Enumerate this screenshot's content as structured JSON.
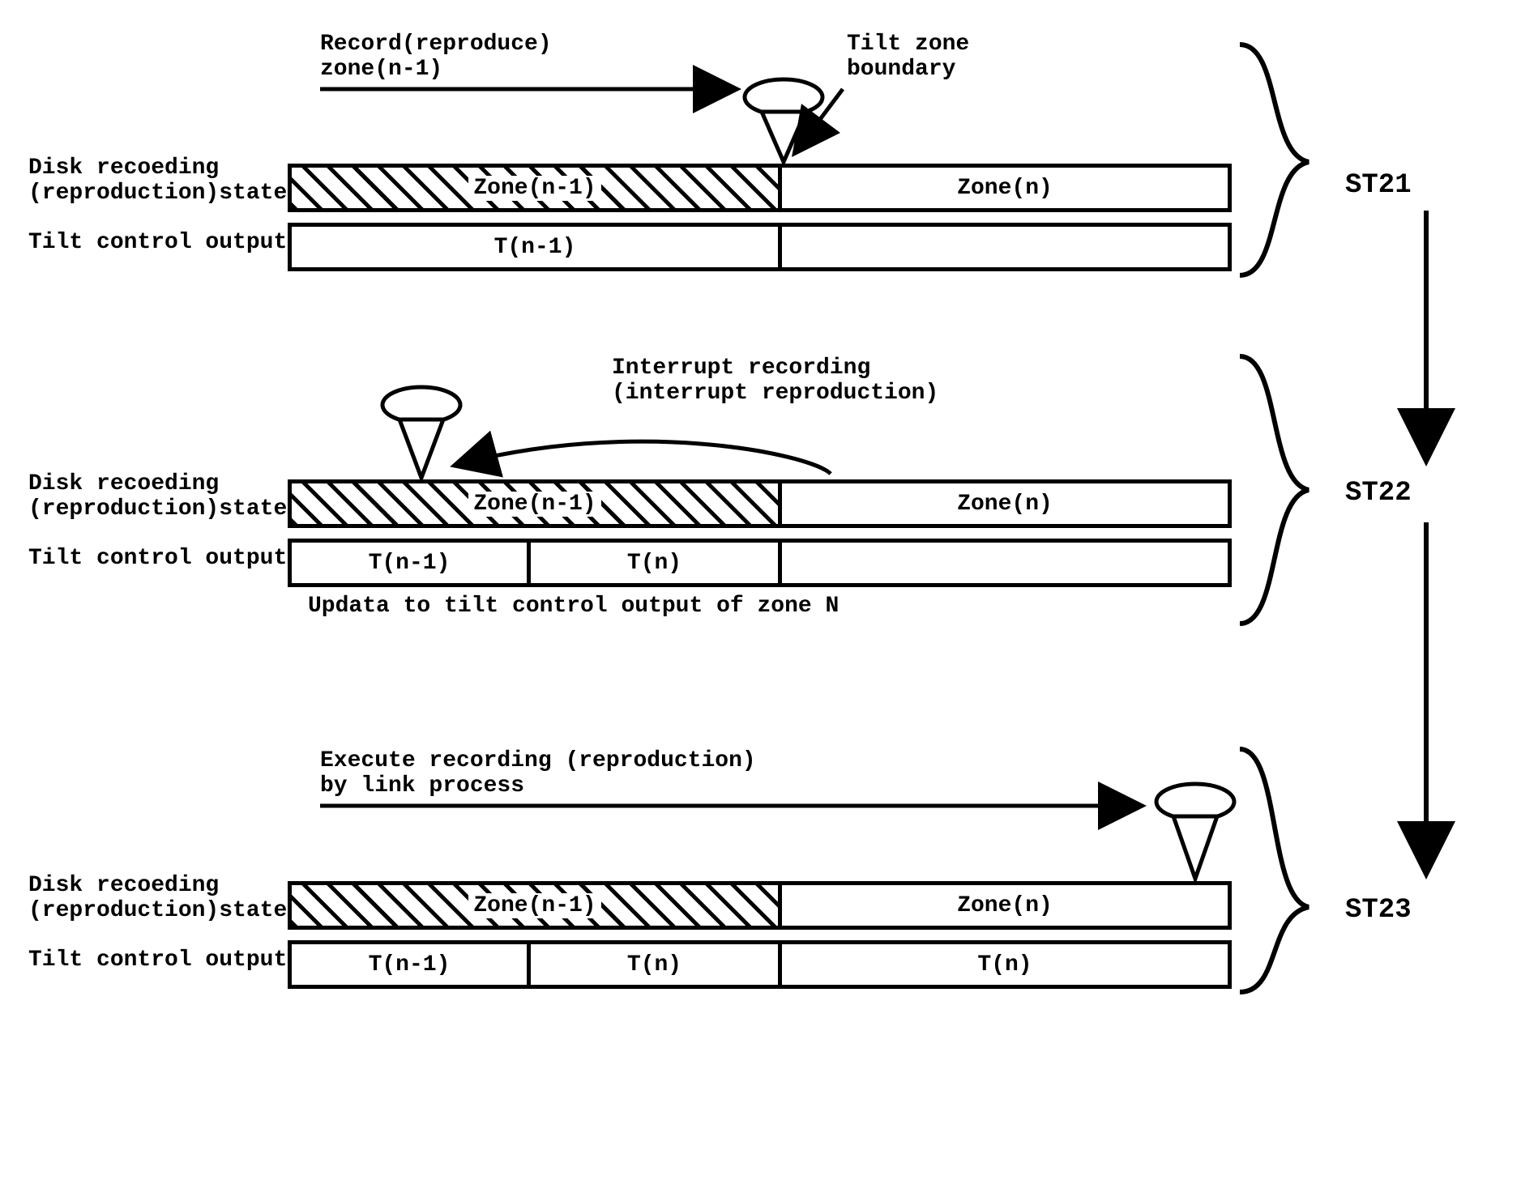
{
  "labels": {
    "disk_state": "Disk recoeding\n(reproduction)state",
    "tilt_out": "Tilt control output",
    "zone_nm1": "Zone(n-1)",
    "zone_n": "Zone(n)",
    "t_nm1": "T(n-1)",
    "t_n": "T(n)"
  },
  "st21": {
    "caption1": "Record(reproduce)\nzone(n-1)",
    "caption2": "Tilt zone\nboundary",
    "tag": "ST21"
  },
  "st22": {
    "caption1": "Interrupt recording\n(interrupt reproduction)",
    "update_note": "Updata to tilt control output of zone N",
    "tag": "ST22"
  },
  "st23": {
    "caption1": "Execute recording (reproduction)\nby link process",
    "tag": "ST23"
  }
}
